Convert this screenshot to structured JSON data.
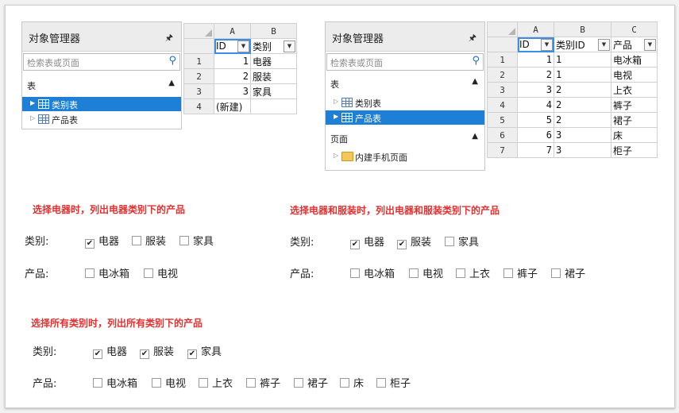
{
  "object_manager": {
    "title": "对象管理器",
    "pin_icon": "pin-icon",
    "search_placeholder": "检索表或页面",
    "section_tables": "表",
    "section_pages": "页面",
    "items": {
      "category": "类别表",
      "product": "产品表",
      "mobile_page": "内建手机页面"
    }
  },
  "grid1": {
    "col_headers": [
      "A",
      "B"
    ],
    "field_headers": [
      "ID",
      "类别"
    ],
    "rows": [
      {
        "n": "1",
        "id": "1",
        "name": "电器"
      },
      {
        "n": "2",
        "id": "2",
        "name": "服装"
      },
      {
        "n": "3",
        "id": "3",
        "name": "家具"
      }
    ],
    "new_row": {
      "n": "4",
      "label": "(新建)"
    }
  },
  "grid2": {
    "col_headers": [
      "A",
      "B",
      "C"
    ],
    "field_headers": [
      "ID",
      "类别ID",
      "产品"
    ],
    "rows": [
      {
        "n": "1",
        "id": "1",
        "cat": "1",
        "name": "电冰箱"
      },
      {
        "n": "2",
        "id": "2",
        "cat": "1",
        "name": "电视"
      },
      {
        "n": "3",
        "id": "3",
        "cat": "2",
        "name": "上衣"
      },
      {
        "n": "4",
        "id": "4",
        "cat": "2",
        "name": "裤子"
      },
      {
        "n": "5",
        "id": "5",
        "cat": "2",
        "name": "裙子"
      },
      {
        "n": "6",
        "id": "6",
        "cat": "3",
        "name": "床"
      },
      {
        "n": "7",
        "id": "7",
        "cat": "3",
        "name": "柜子"
      }
    ]
  },
  "examples": {
    "ex1": {
      "caption": "选择电器时，列出电器类别下的产品",
      "cat_label": "类别:",
      "prod_label": "产品:",
      "categories": [
        {
          "label": "电器",
          "checked": true
        },
        {
          "label": "服装",
          "checked": false
        },
        {
          "label": "家具",
          "checked": false
        }
      ],
      "products": [
        {
          "label": "电冰箱",
          "checked": false
        },
        {
          "label": "电视",
          "checked": false
        }
      ]
    },
    "ex2": {
      "caption": "选择电器和服装时，列出电器和服装类别下的产品",
      "cat_label": "类别:",
      "prod_label": "产品:",
      "categories": [
        {
          "label": "电器",
          "checked": true
        },
        {
          "label": "服装",
          "checked": true
        },
        {
          "label": "家具",
          "checked": false
        }
      ],
      "products": [
        {
          "label": "电冰箱",
          "checked": false
        },
        {
          "label": "电视",
          "checked": false
        },
        {
          "label": "上衣",
          "checked": false
        },
        {
          "label": "裤子",
          "checked": false
        },
        {
          "label": "裙子",
          "checked": false
        }
      ]
    },
    "ex3": {
      "caption": "选择所有类别时，列出所有类别下的产品",
      "cat_label": "类别:",
      "prod_label": "产品:",
      "categories": [
        {
          "label": "电器",
          "checked": true
        },
        {
          "label": "服装",
          "checked": true
        },
        {
          "label": "家具",
          "checked": true
        }
      ],
      "products": [
        {
          "label": "电冰箱",
          "checked": false
        },
        {
          "label": "电视",
          "checked": false
        },
        {
          "label": "上衣",
          "checked": false
        },
        {
          "label": "裤子",
          "checked": false
        },
        {
          "label": "裙子",
          "checked": false
        },
        {
          "label": "床",
          "checked": false
        },
        {
          "label": "柜子",
          "checked": false
        }
      ]
    }
  },
  "colors": {
    "selection": "#1e7fd6",
    "caption": "#e03232",
    "active_cell": "#3a8ee6"
  }
}
